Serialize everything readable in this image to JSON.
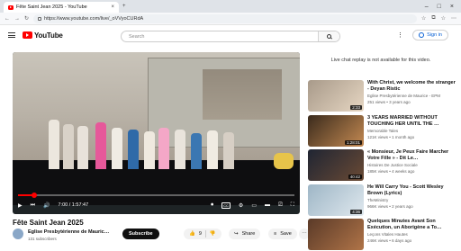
{
  "browser": {
    "tab_title": "Fête Saint Jean 2025 - YouTube",
    "tab_close": "×",
    "new_tab": "+",
    "window_controls": [
      "–",
      "□",
      "×"
    ],
    "nav": [
      "←",
      "→",
      "↻"
    ],
    "url": "https://www.youtube.com/live/_oVVyoCURdA",
    "url_icons": [
      "☆",
      "⧉",
      "☆",
      "⋯"
    ]
  },
  "yt": {
    "logo_text": "YouTube",
    "search_placeholder": "Search",
    "more": "⋮",
    "sign_in": "Sign in"
  },
  "player": {
    "time": "7:00 / 1:57:47",
    "progress_fraction": 0.06,
    "cc_label": "CC"
  },
  "video": {
    "title": "Fête Saint Jean 2025",
    "channel": "Église Presbytérienne de Maurice…",
    "subscribers": "131 subscribers",
    "subscribe_label": "Subscribe",
    "likes": "9",
    "share_label": "Share",
    "save_label": "Save",
    "more_label": "⋯"
  },
  "sidebar": {
    "live_note": "Live chat replay is not available for this video.",
    "recommendations": [
      {
        "title": "With Christ, we welcome the stranger - Deyan Ristic",
        "channel": "Eglise Presbytérienne de Maurice - EPM",
        "meta": "251 views • 3 years ago",
        "duration": "2:33",
        "colors": [
          "#a89a8a",
          "#e6d6c2"
        ]
      },
      {
        "title": "3 YEARS MARRIED WITHOUT TOUCHING HER UNTIL THE …",
        "channel": "Memorable Tales",
        "meta": "121K views • 1 month ago",
        "duration": "1:28:01",
        "colors": [
          "#3a2a1c",
          "#c48a52"
        ]
      },
      {
        "title": "« Monsieur, Je Peux Faire Marcher Votre Fille » - Dit Le…",
        "channel": "Histoires De Justice Sociale",
        "meta": "185K views • 4 weeks ago",
        "duration": "40:42",
        "colors": [
          "#1f2533",
          "#6a4a34"
        ]
      },
      {
        "title": "He Will Carry You - Scott Wesley Brown (Lyrics)",
        "channel": "TheMinistry",
        "meta": "966K views • 2 years ago",
        "duration": "4:36",
        "colors": [
          "#9eb6c6",
          "#dfe8ee"
        ]
      },
      {
        "title": "Quelques Minutes Avant Son Exécution, un Aborigène a To…",
        "channel": "Leçons Vitales Hautes",
        "meta": "246K views • 6 days ago",
        "duration": "",
        "colors": [
          "#5a3a28",
          "#b07448"
        ]
      }
    ]
  }
}
